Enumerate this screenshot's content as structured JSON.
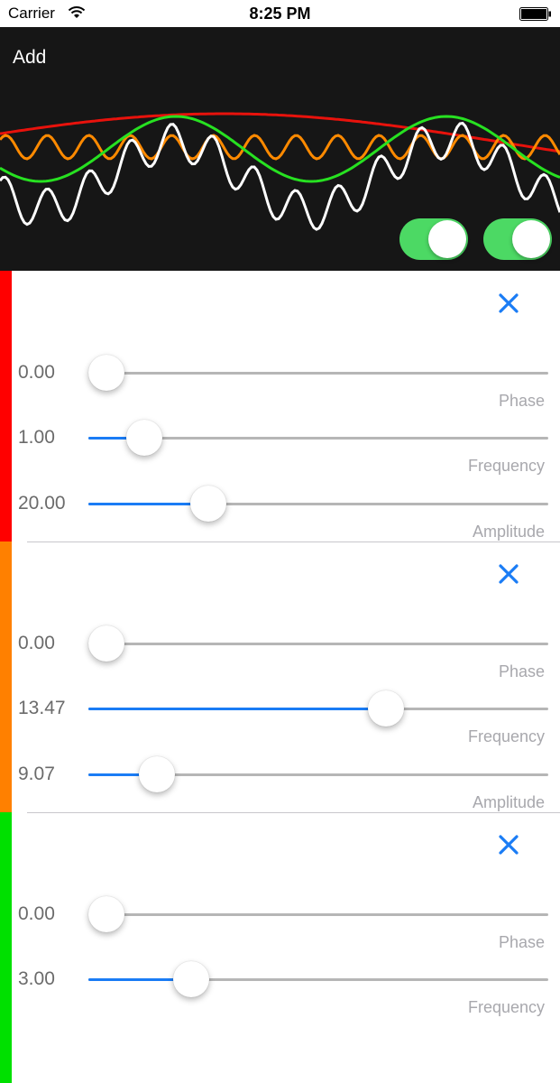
{
  "status_bar": {
    "carrier": "Carrier",
    "time": "8:25 PM"
  },
  "graph": {
    "add_label": "Add",
    "toggles": [
      {
        "on": true
      },
      {
        "on": true
      }
    ],
    "wave_colors": {
      "red": "#e8120c",
      "orange": "#ff8a00",
      "green": "#27e121",
      "white": "#ffffff"
    }
  },
  "waves": [
    {
      "color": "#ff0000",
      "sliders": [
        {
          "value": "0.00",
          "caption": "Phase",
          "fraction": 0.0
        },
        {
          "value": "1.00",
          "caption": "Frequency",
          "fraction": 0.09
        },
        {
          "value": "20.00",
          "caption": "Amplitude",
          "fraction": 0.24
        }
      ]
    },
    {
      "color": "#ff8000",
      "sliders": [
        {
          "value": "0.00",
          "caption": "Phase",
          "fraction": 0.0
        },
        {
          "value": "13.47",
          "caption": "Frequency",
          "fraction": 0.66
        },
        {
          "value": "9.07",
          "caption": "Amplitude",
          "fraction": 0.12
        }
      ]
    },
    {
      "color": "#00e000",
      "sliders": [
        {
          "value": "0.00",
          "caption": "Phase",
          "fraction": 0.0
        },
        {
          "value": "3.00",
          "caption": "Frequency",
          "fraction": 0.2
        }
      ]
    }
  ]
}
